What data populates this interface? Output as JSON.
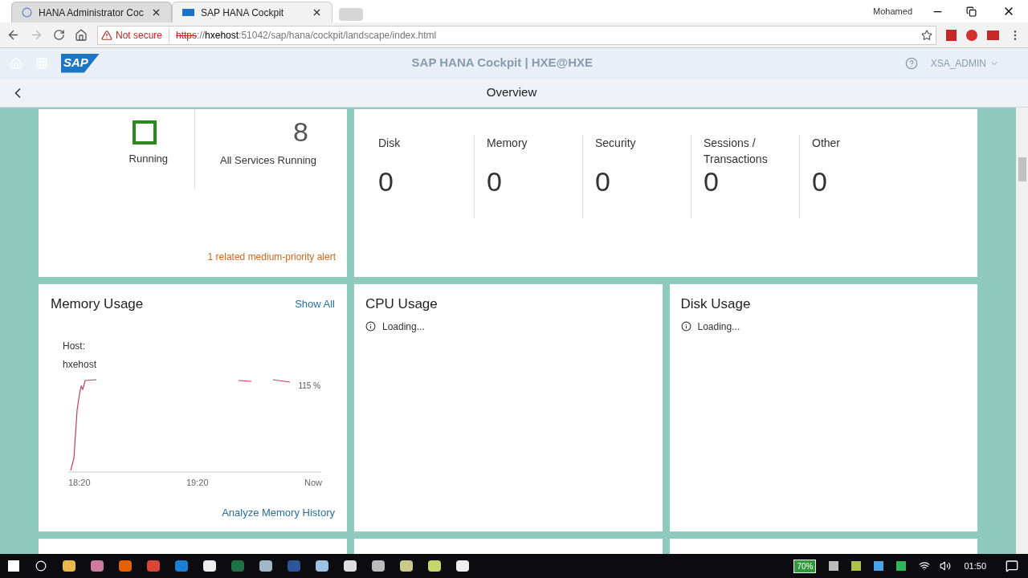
{
  "browser": {
    "tabs": [
      {
        "title": "HANA Administrator Coc",
        "selected": false,
        "loading": true
      },
      {
        "title": "SAP HANA Cockpit",
        "selected": true,
        "loading": false
      }
    ],
    "user": "Mohamed",
    "security": "Not secure",
    "url_scheme": "https",
    "url_sep": "://",
    "url_host": "hxehost",
    "url_rest": ":51042/sap/hana/cockpit/landscape/index.html"
  },
  "shell": {
    "logo": "SAP",
    "title": "SAP HANA Cockpit | HXE@HXE",
    "user": "XSA_ADMIN"
  },
  "page": {
    "title": "Overview"
  },
  "status_tile": {
    "state": "Running",
    "count": "8",
    "count_label": "All Services Running",
    "alert": "1 related medium-priority alert"
  },
  "alerts_tile": {
    "categories": [
      {
        "label": "Disk",
        "value": "0"
      },
      {
        "label": "Memory",
        "value": "0"
      },
      {
        "label": "Security",
        "value": "0"
      },
      {
        "label": "Sessions / Transactions",
        "value": "0"
      },
      {
        "label": "Other",
        "value": "0"
      }
    ]
  },
  "memory_tile": {
    "title": "Memory Usage",
    "action": "Show All",
    "host_label": "Host:",
    "host": "hxehost",
    "value_label": "115 %",
    "x_labels": [
      "18:20",
      "19:20",
      "Now"
    ],
    "footer_link": "Analyze Memory History"
  },
  "loading_tiles": [
    {
      "title": "CPU Usage",
      "status": "Loading..."
    },
    {
      "title": "Disk Usage",
      "status": "Loading..."
    }
  ],
  "taskbar": {
    "battery": "70%",
    "time": "01:50"
  }
}
